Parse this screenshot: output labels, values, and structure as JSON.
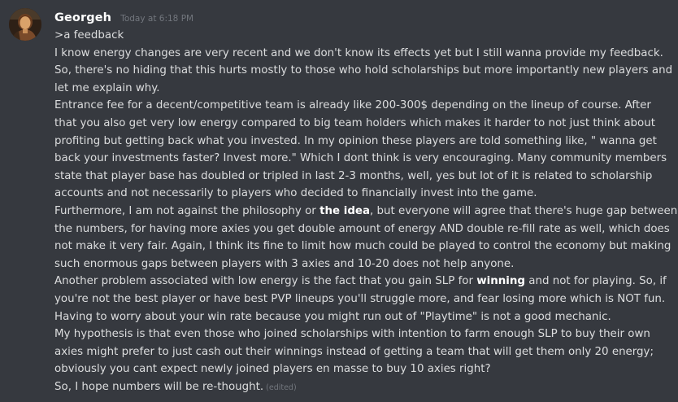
{
  "message": {
    "username": "Georgeh",
    "timestamp": "Today at 6:18 PM",
    "lines": [
      {
        "parts": [
          ">a feedback"
        ]
      },
      {
        "parts": [
          "I know energy changes are very recent and we don't know its effects yet but I still wanna provide my feedback."
        ]
      },
      {
        "parts": [
          "So, there's no hiding that this hurts mostly to those who hold scholarships but more importantly new players and"
        ]
      },
      {
        "parts": [
          "let me explain why."
        ]
      },
      {
        "parts": [
          "Entrance fee for a decent/competitive team is already like 200-300$ depending on the lineup of course.  After"
        ]
      },
      {
        "parts": [
          "that you also get very low energy compared to big team holders which makes it harder to not just think about"
        ]
      },
      {
        "parts": [
          "profiting but getting back what you invested. In my opinion these players are told something like, \" wanna get"
        ]
      },
      {
        "parts": [
          "back your investments faster? Invest more.\" Which I dont think is very encouraging. Many community members"
        ]
      },
      {
        "parts": [
          "state that player base has doubled or tripled in last 2-3 months, well, yes but lot of it is related to scholarship"
        ]
      },
      {
        "parts": [
          "accounts and not necessarily to players who decided to financially invest into the game."
        ]
      },
      {
        "parts": [
          "Furthermore, I am not against the philosophy or ",
          "the idea",
          ", but everyone will agree that there's huge gap between"
        ]
      },
      {
        "parts": [
          "the numbers, for having more axies you get double amount of energy AND double re-fill rate as well, which does"
        ]
      },
      {
        "parts": [
          "not make it very fair. Again, I think its fine to limit how much could be played to control the economy but making"
        ]
      },
      {
        "parts": [
          "such enormous gaps between players with 3 axies and 10-20 does not help anyone."
        ]
      },
      {
        "parts": [
          "Another problem associated with low energy is the fact that you gain SLP for ",
          "winning",
          " and not for playing. So, if"
        ]
      },
      {
        "parts": [
          "you're not the best player or have best PVP lineups you'll struggle more, and fear losing more which is NOT fun."
        ]
      },
      {
        "parts": [
          "Having to worry about your win rate because you might run out of \"Playtime\" is not a good mechanic."
        ]
      },
      {
        "parts": [
          "My hypothesis is that even those who joined scholarships with intention to farm enough SLP to buy their own"
        ]
      },
      {
        "parts": [
          "axies might prefer to just cash out their winnings instead of getting a team that will get them only 20 energy;"
        ]
      },
      {
        "parts": [
          "obviously you cant expect newly joined players en masse to buy 10 axies right?"
        ]
      },
      {
        "parts": [
          "So, I hope numbers will be re-thought."
        ]
      }
    ],
    "edited_label": "(edited)"
  }
}
